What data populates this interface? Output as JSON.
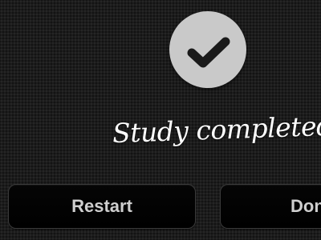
{
  "status": {
    "icon": "checkmark-icon",
    "title": "Study completed"
  },
  "actions": {
    "restart_label": "Restart",
    "done_label": "Done"
  },
  "colors": {
    "background": "#1c1c1c",
    "icon_circle": "#c9c9c9",
    "icon_check": "#1a1a1a",
    "button_text": "#cfcfcf"
  }
}
